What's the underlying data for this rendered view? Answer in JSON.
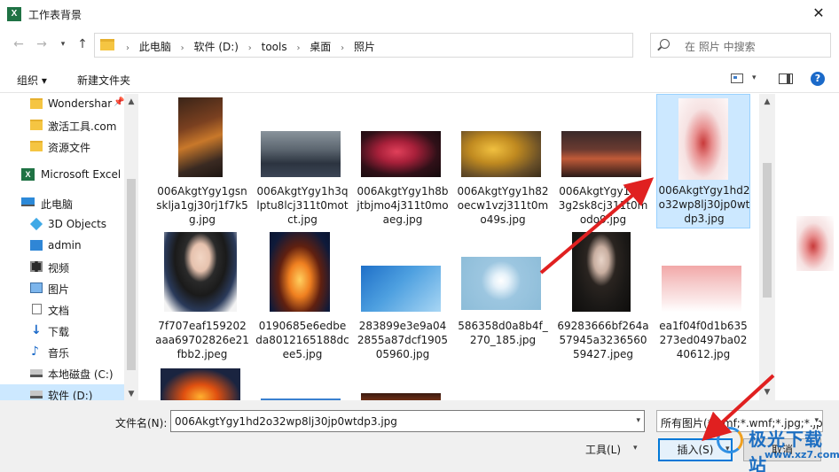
{
  "window": {
    "title": "工作表背景",
    "app_icon": "excel-icon",
    "close_label": "✕"
  },
  "nav": {
    "back_icon": "back-arrow-icon",
    "forward_icon": "forward-arrow-icon",
    "recent_icon": "chevron-down-icon",
    "up_icon": "up-arrow-icon",
    "breadcrumb": [
      "此电脑",
      "软件 (D:)",
      "tools",
      "桌面",
      "照片"
    ],
    "refresh_icon": "refresh-icon",
    "search_placeholder": "在 照片 中搜索"
  },
  "toolbar": {
    "organize": "组织 ▾",
    "new_folder": "新建文件夹"
  },
  "sidebar": {
    "items": [
      {
        "label": "Wondershar",
        "icon": "folder-icon",
        "pinned": true
      },
      {
        "label": "激活工具.com",
        "icon": "folder-icon"
      },
      {
        "label": "资源文件",
        "icon": "folder-icon"
      },
      {
        "label": "Microsoft Excel",
        "icon": "excel-icon"
      },
      {
        "label": "此电脑",
        "icon": "pc-icon"
      },
      {
        "label": "3D Objects",
        "icon": "3d-objects-icon"
      },
      {
        "label": "admin",
        "icon": "user-folder-icon"
      },
      {
        "label": "视频",
        "icon": "video-icon"
      },
      {
        "label": "图片",
        "icon": "pictures-icon"
      },
      {
        "label": "文档",
        "icon": "documents-icon"
      },
      {
        "label": "下载",
        "icon": "download-icon"
      },
      {
        "label": "音乐",
        "icon": "music-icon"
      },
      {
        "label": "本地磁盘 (C:)",
        "icon": "disk-icon"
      },
      {
        "label": "软件 (D:)",
        "icon": "disk-icon",
        "selected": true
      }
    ]
  },
  "files": [
    {
      "name": "006AkgtYgy1gsnsklja1gj30rj1f7k5g.jpg"
    },
    {
      "name": "006AkgtYgy1h3qlptu8lcj311t0motct.jpg"
    },
    {
      "name": "006AkgtYgy1h8bjtbjmo4j311t0moaeg.jpg"
    },
    {
      "name": "006AkgtYgy1h82oecw1vzj311t0mo49s.jpg"
    },
    {
      "name": "006AkgtYgy1h8f3g2sk8cj311t0modo9.jpg"
    },
    {
      "name": "006AkgtYgy1hd2o32wp8lj30jp0wtdp3.jpg",
      "selected": true
    },
    {
      "name": "7f707eaf159202aaa69702826e21fbb2.jpeg"
    },
    {
      "name": "0190685e6edbeda8012165188dcee5.jpg"
    },
    {
      "name": "283899e3e9a042855a87dcf190505960.jpg"
    },
    {
      "name": "586358d0a8b4f_270_185.jpg"
    },
    {
      "name": "69283666bf264a57945a323656059427.jpeg"
    },
    {
      "name": "ea1f04f0d1b635273ed0497ba0240612.jpg"
    }
  ],
  "bottom": {
    "filename_label": "文件名(N):",
    "filename_value": "006AkgtYgy1hd2o32wp8lj30jp0wtdp3.jpg",
    "filetype_value": "所有图片(*.emf;*.wmf;*.jpg;*.jp",
    "tools_label": "工具(L)",
    "insert_label": "插入(S)",
    "cancel_label": "取消"
  },
  "watermark": {
    "title": "极光下载站",
    "url": "www.xz7.com"
  },
  "colors": {
    "selection": "#cce8ff",
    "accent": "#0078d7",
    "annotation_arrow": "#e02020"
  }
}
